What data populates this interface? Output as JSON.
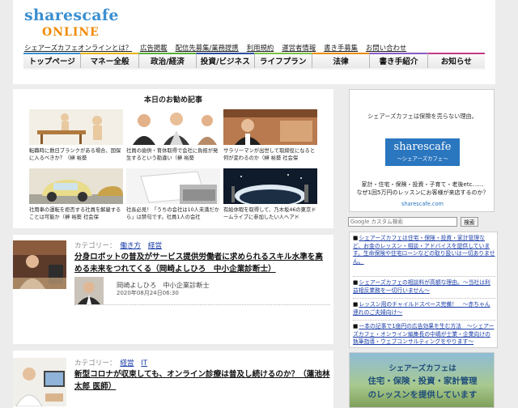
{
  "header": {
    "logo_main": "sharescafe",
    "logo_sub": "ONLINE",
    "top_links": [
      "シェアーズカフェオンラインとは？",
      "広告掲載",
      "配信先募集/業務提携",
      "利用規約",
      "運営者情報",
      "書き手募集",
      "お問い合わせ"
    ],
    "nav": [
      {
        "label": "トップページ",
        "color": "#3a8fd0"
      },
      {
        "label": "マネー全般",
        "color": "#e5b400"
      },
      {
        "label": "政治/経済",
        "color": "#5aaf3c"
      },
      {
        "label": "投資/ビジネス",
        "color": "#2d4f9e"
      },
      {
        "label": "ライフプラン",
        "color": "#7bc043"
      },
      {
        "label": "法律",
        "color": "#f08a00"
      },
      {
        "label": "書き手紹介",
        "color": "#8a5bc4"
      },
      {
        "label": "お知らせ",
        "color": "#c43a8a"
      }
    ]
  },
  "recommend": {
    "title": "本日のお勧め記事",
    "items": [
      {
        "caption": "転職時に数日ブランクがある場合、国保に入るべきか？（榊 裕葵"
      },
      {
        "caption": "社員の歯供・育休取得で会社に負担が発生するという勘違い（榊 裕葵"
      },
      {
        "caption": "サラリーマンが出世して取締役になると何が変わるのか（榊 裕葵 社会保"
      },
      {
        "caption": "社用車の運転を拒否する社員を解雇することは可能か（榊 裕葵 社会保"
      },
      {
        "caption": "社長必見！「うちの会社は10人未満だから」は禁句です。社員1人の会社"
      },
      {
        "caption": "有給休暇を取得して、乃木坂46の東京ドームライブに参加したい人へアド"
      }
    ]
  },
  "articles": [
    {
      "category_label": "カテゴリー：",
      "categories": [
        "働き方",
        "経営"
      ],
      "title": "分身ロボットの普及がサービス提供労働者に求められるスキル水準を高める未来をつれてくる（岡崎よしひろ　中小企業診断士）",
      "author": "岡崎よしひろ　中小企業診断士",
      "date": "2020年08月24日06:30"
    },
    {
      "category_label": "カテゴリー：",
      "categories": [
        "経営",
        "IT"
      ],
      "title": "新型コロナが収束しても、オンライン診療は普及し続けるのか？（蓮池林太郎 医師）"
    }
  ],
  "sidebar": {
    "ad1_head": "シェアーズカフェは保険を売らない理由。",
    "ad1_logo": "sharescafe",
    "ad1_logo_sub": "〜シェアーズカフェ〜",
    "ad1_body_1": "家計・住宅・保険・投資・子育て・老後etc……",
    "ad1_body_2": "なぜ1回5万円のレッスンにお客様が来店するのか？",
    "ad1_url": "sharescafe.com",
    "search_placeholder": "Google カスタム検索",
    "search_button": "検索",
    "news": [
      "シェアーズカフェは住宅・保険・投資・家計管理など、お金のレッスン・相談・アドバイスを提供しています。生命保険や住宅ローンなどの取り扱いは一切ありません。",
      "シェアーズカフェの相談料が高額な理由。〜当社は利益相反業務を一切行いません〜",
      "レッスン用のチャイルドスペース完備！　〜赤ちゃん連れのご夫婦向け〜",
      "一本の記事で1億円の広告効果を生む方法　〜シェアーズカフェ・オンライン編集長の中嶋が士業・企業向けの執筆指導・ウェブコンサルティングをやります〜"
    ],
    "ad2_1": "シェアーズカフェは",
    "ad2_2": "住宅・保険・投資・家計管理",
    "ad2_3": "のレッスンを提供しています"
  }
}
